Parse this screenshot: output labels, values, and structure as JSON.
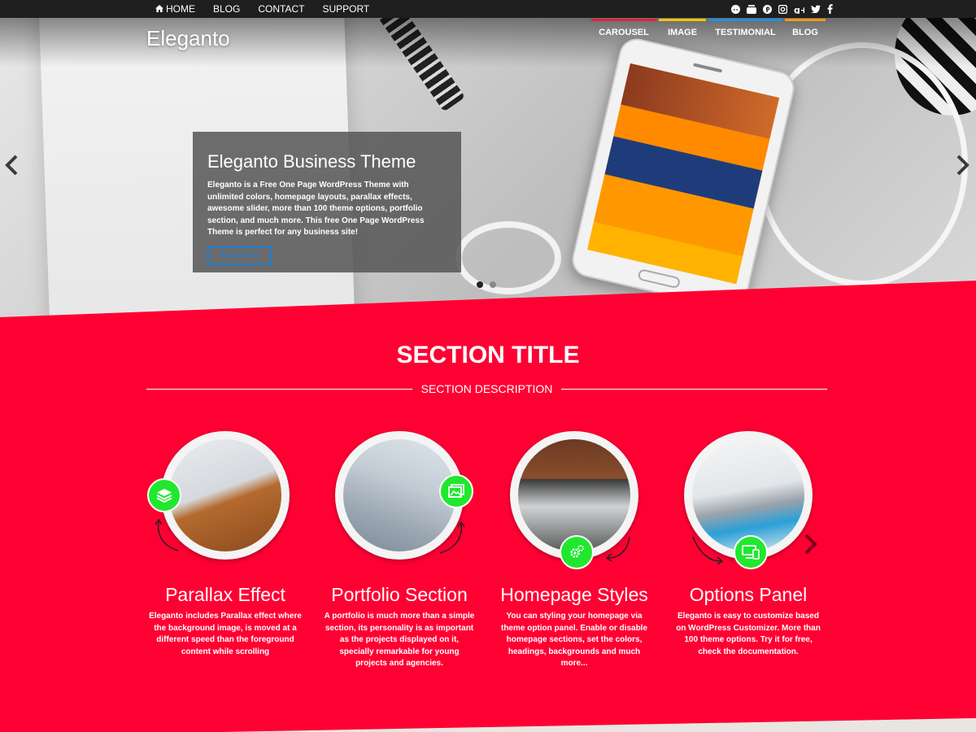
{
  "topbar": {
    "nav": [
      {
        "label": "HOME",
        "icon": "home-icon"
      },
      {
        "label": "BLOG"
      },
      {
        "label": "CONTACT"
      },
      {
        "label": "SUPPORT"
      }
    ],
    "social_icons": [
      "reddit-icon",
      "youtube-icon",
      "pinterest-icon",
      "instagram-icon",
      "google-plus-icon",
      "twitter-icon",
      "facebook-icon"
    ]
  },
  "header": {
    "logo": "Eleganto",
    "nav": [
      {
        "label": "CAROUSEL",
        "color": "#e0213e"
      },
      {
        "label": "IMAGE",
        "color": "#f2c500"
      },
      {
        "label": "TESTIMONIAL",
        "color": "#1f8fe0"
      },
      {
        "label": "BLOG",
        "color": "#f29a12"
      }
    ]
  },
  "slider": {
    "title": "Eleganto Business Theme",
    "text": "Eleganto is a Free One Page WordPress Theme with unlimited colors, homepage layouts, parallax effects, awesome slider, more than 100 theme options, portfolio section, and much more. This free One Page WordPress Theme is perfect for any business site!",
    "button": "Read More",
    "slide_count": 2,
    "active_slide": 1
  },
  "section": {
    "title": "SECTION TITLE",
    "description": "SECTION DESCRIPTION",
    "accent": "#ff0033",
    "features": [
      {
        "title": "Parallax Effect",
        "text": "Eleganto includes Parallax effect where the background image, is moved at a different speed than the foreground content while scrolling",
        "icon": "layers-icon"
      },
      {
        "title": "Portfolio Section",
        "text": "A portfolio is much more than a simple section, its personality is as important as the projects displayed on it, specially remarkable for young projects and agencies.",
        "icon": "images-icon"
      },
      {
        "title": "Homepage Styles",
        "text": "You can styling your homepage via theme option panel. Enable or disable homepage sections, set the colors, headings, backgrounds and much more...",
        "icon": "gears-icon"
      },
      {
        "title": "Options Panel",
        "text": "Eleganto is easy to customize based on WordPress Customizer. More than 100 theme options. Try it for free, check the documentation.",
        "icon": "devices-icon"
      }
    ]
  }
}
